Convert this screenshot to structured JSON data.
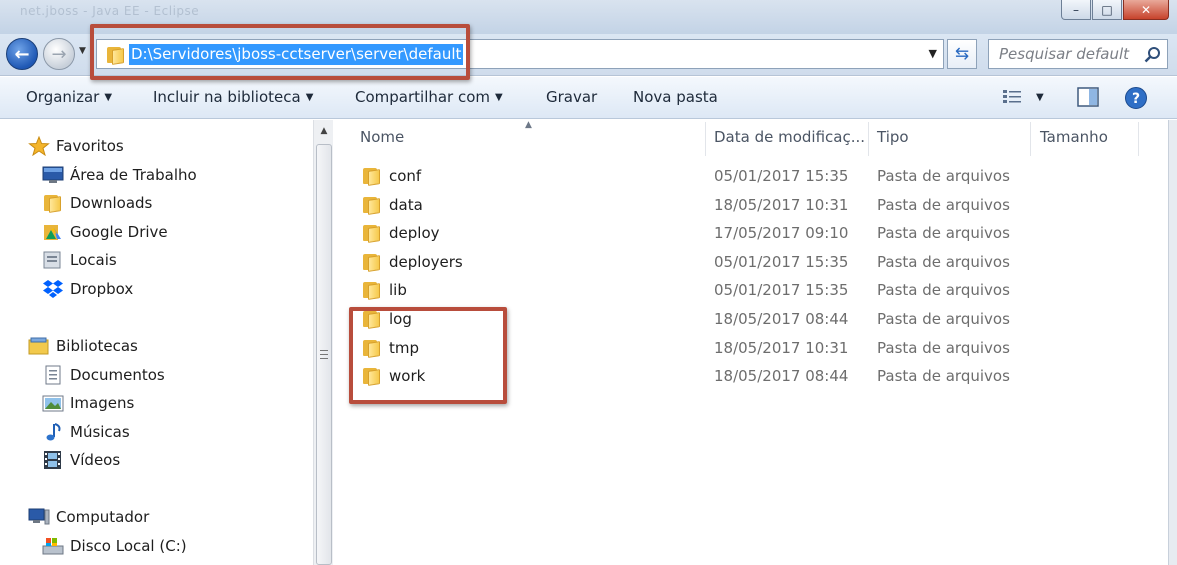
{
  "window": {
    "title_blurred": "net.jboss - Java EE - Eclipse",
    "buttons": {
      "minimize": "–",
      "maximize": "□",
      "close": "✕"
    }
  },
  "nav": {
    "back_glyph": "←",
    "forward_glyph": "→",
    "address": "D:\\Servidores\\jboss-cctserver\\server\\default",
    "search_placeholder": "Pesquisar default"
  },
  "toolbar": {
    "organize": "Organizar",
    "include_library": "Incluir na biblioteca",
    "share": "Compartilhar com",
    "burn": "Gravar",
    "new_folder": "Nova pasta"
  },
  "sidebar": {
    "favorites": {
      "label": "Favoritos",
      "items": [
        "Área de Trabalho",
        "Downloads",
        "Google Drive",
        "Locais",
        "Dropbox"
      ]
    },
    "libraries": {
      "label": "Bibliotecas",
      "items": [
        "Documentos",
        "Imagens",
        "Músicas",
        "Vídeos"
      ]
    },
    "computer": {
      "label": "Computador",
      "items": [
        "Disco Local (C:)"
      ]
    }
  },
  "columns": {
    "name": "Nome",
    "date": "Data de modificaç...",
    "type": "Tipo",
    "size": "Tamanho"
  },
  "files": [
    {
      "name": "conf",
      "date": "05/01/2017 15:35",
      "type": "Pasta de arquivos"
    },
    {
      "name": "data",
      "date": "18/05/2017 10:31",
      "type": "Pasta de arquivos"
    },
    {
      "name": "deploy",
      "date": "17/05/2017 09:10",
      "type": "Pasta de arquivos"
    },
    {
      "name": "deployers",
      "date": "05/01/2017 15:35",
      "type": "Pasta de arquivos"
    },
    {
      "name": "lib",
      "date": "05/01/2017 15:35",
      "type": "Pasta de arquivos"
    },
    {
      "name": "log",
      "date": "18/05/2017 08:44",
      "type": "Pasta de arquivos"
    },
    {
      "name": "tmp",
      "date": "18/05/2017 10:31",
      "type": "Pasta de arquivos"
    },
    {
      "name": "work",
      "date": "18/05/2017 08:44",
      "type": "Pasta de arquivos"
    }
  ],
  "colors": {
    "annotation_red": "#b84d3c",
    "selection_blue": "#3399ff"
  }
}
